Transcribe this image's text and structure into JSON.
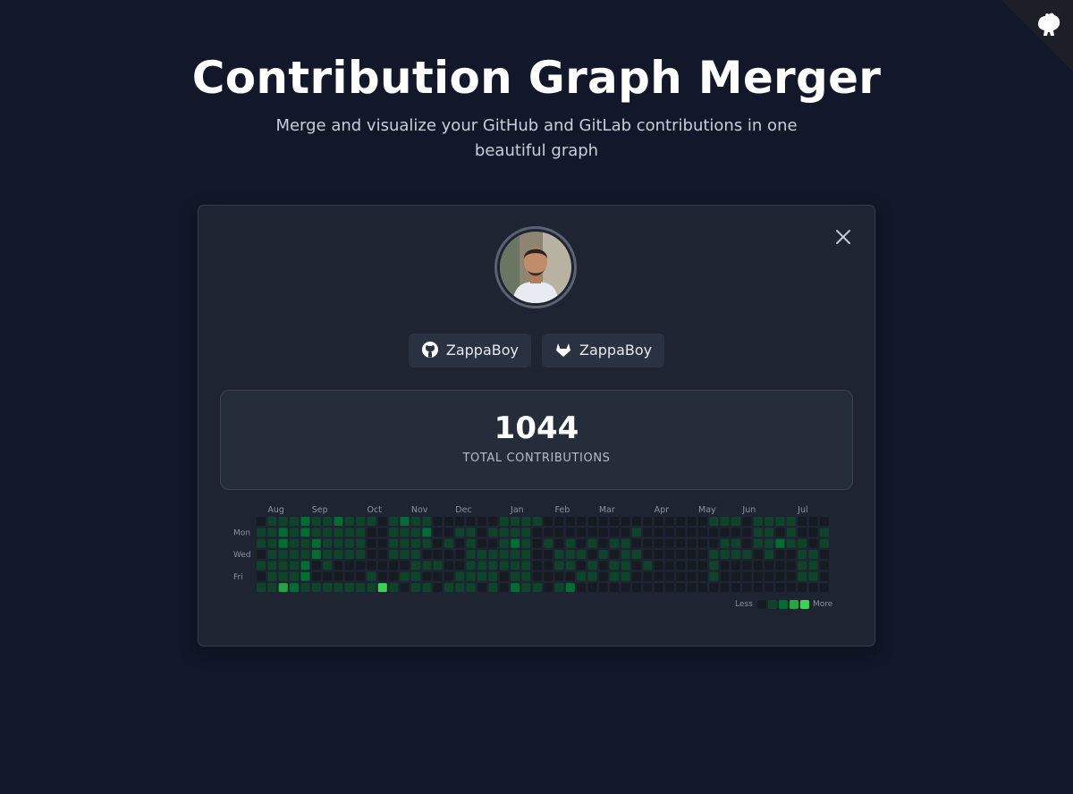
{
  "header": {
    "title": "Contribution Graph Merger",
    "subtitle": "Merge and visualize your GitHub and GitLab contributions in one beautiful graph"
  },
  "corner": {
    "icon": "github-octocat-icon"
  },
  "card": {
    "close_icon": "close-icon",
    "avatar_icon": "user-avatar",
    "accounts": [
      {
        "icon": "github-icon",
        "label": "ZappaBoy"
      },
      {
        "icon": "gitlab-icon",
        "label": "ZappaBoy"
      }
    ],
    "stats": {
      "total": "1044",
      "label": "TOTAL CONTRIBUTIONS"
    }
  },
  "graph": {
    "months": [
      "Aug",
      "Sep",
      "Oct",
      "Nov",
      "Dec",
      "Jan",
      "Feb",
      "Mar",
      "Apr",
      "May",
      "Jun",
      "Jul"
    ],
    "month_start_week": [
      1,
      5,
      10,
      14,
      18,
      23,
      27,
      31,
      36,
      40,
      44,
      49
    ],
    "day_labels": [
      "Mon",
      "Wed",
      "Fri"
    ],
    "day_label_rows": [
      1,
      3,
      5
    ],
    "colors": [
      "#161b22",
      "#0e4429",
      "#006d32",
      "#26a641",
      "#39d353"
    ],
    "legend": {
      "less": "Less",
      "more": "More"
    },
    "levels": [
      "0111211211101211000000111100000000000000011101111000",
      "1121211111001112001101111000000000100000000001101001",
      "1121121111001111010100121010101011000000001101121101",
      "0111121111001110000111111001110101100000011110100110",
      "1111201000000011100111111001101011010000010000000110",
      "0111200000100110001111011000011011000000010000000110",
      "1132111111141011011101021101200000000000000000000000"
    ]
  }
}
